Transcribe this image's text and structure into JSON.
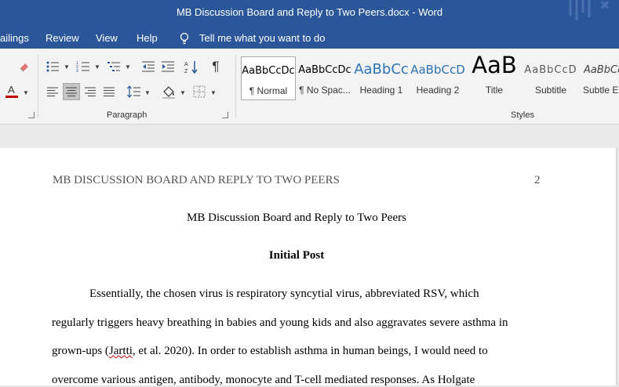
{
  "window": {
    "title": "MB Discussion Board and Reply to Two Peers.docx  -  Word"
  },
  "menu": {
    "items": [
      "ailings",
      "Review",
      "View",
      "Help"
    ],
    "tell_me": "Tell me what you want to do"
  },
  "ribbon": {
    "paragraph_label": "Paragraph",
    "styles_label": "Styles",
    "styles": [
      {
        "preview": "AaBbCcDc",
        "name": "¶ Normal"
      },
      {
        "preview": "AaBbCcDc",
        "name": "¶ No Spac..."
      },
      {
        "preview": "AaBbCc",
        "name": "Heading 1"
      },
      {
        "preview": "AaBbCcD",
        "name": "Heading 2"
      },
      {
        "preview": "AaB",
        "name": "Title"
      },
      {
        "preview": "AaBbCcD",
        "name": "Subtitle"
      },
      {
        "preview": "AaBbCcD",
        "name": "Subtle Em"
      }
    ],
    "colors": {
      "accent": "#2b579a",
      "font_color_bar": "#c00000"
    }
  },
  "document": {
    "header": "MB DISCUSSION BOARD AND REPLY TO TWO PEERS",
    "page_number": "2",
    "title": "MB Discussion Board and Reply to Two Peers",
    "heading": "Initial Post",
    "lines": [
      "Essentially, the chosen virus is respiratory syncytial virus, abbreviated RSV, which",
      "regularly triggers heavy breathing in babies and young kids and also aggravates severe asthma in",
      {
        "before": "grown-ups (",
        "misspelled": "Jartti",
        "after": ", et al. 2020). In order to establish asthma in human beings, I would need to"
      },
      "overcome various antigen, antibody, monocyte and T-cell mediated responses. As Holgate"
    ]
  }
}
